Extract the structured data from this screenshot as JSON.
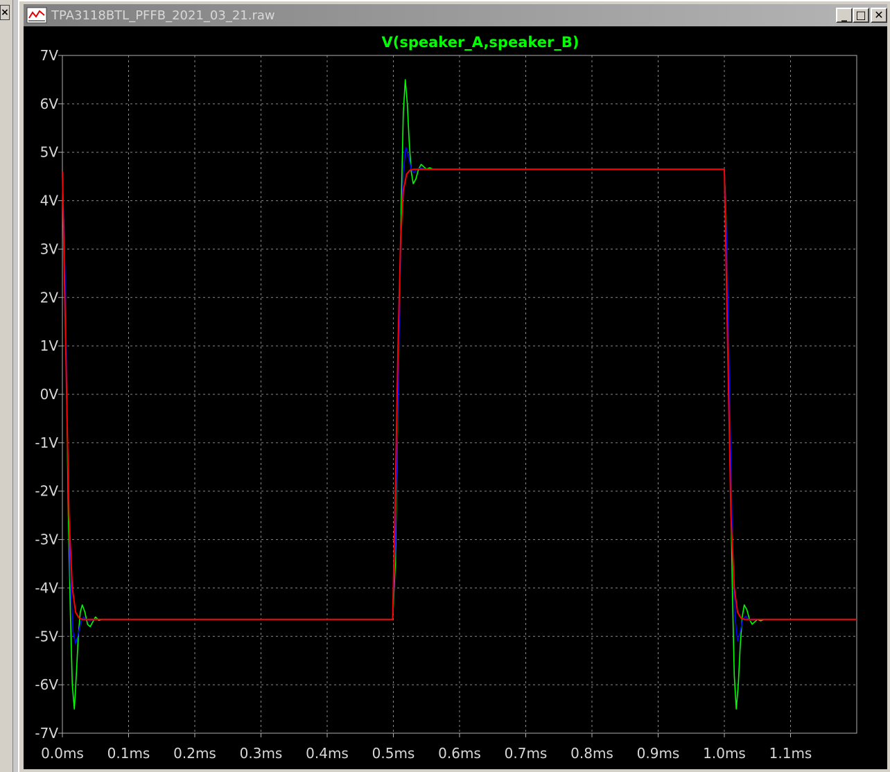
{
  "window": {
    "title": "TPA3118BTL_PFFB_2021_03_21.raw",
    "minimize_label": "_",
    "restore_label": "□",
    "close_label": "✕",
    "left_close_label": "×"
  },
  "plot": {
    "trace_title": "V(speaker_A,speaker_B)",
    "title_color": "#00ff00",
    "background": "#000000"
  },
  "chart_data": {
    "type": "line",
    "title": "V(speaker_A,speaker_B)",
    "xlabel": "",
    "ylabel": "",
    "x_unit": "ms",
    "y_unit": "V",
    "xlim": [
      0.0,
      1.2
    ],
    "ylim": [
      -7,
      7
    ],
    "grid": true,
    "x_ticks": [
      "0.0ms",
      "0.1ms",
      "0.2ms",
      "0.3ms",
      "0.4ms",
      "0.5ms",
      "0.6ms",
      "0.7ms",
      "0.8ms",
      "0.9ms",
      "1.0ms",
      "1.1ms"
    ],
    "y_ticks": [
      "7V",
      "6V",
      "5V",
      "4V",
      "3V",
      "2V",
      "1V",
      "0V",
      "-1V",
      "-2V",
      "-3V",
      "-4V",
      "-5V",
      "-6V",
      "-7V"
    ],
    "series": [
      {
        "color": "#00ff00",
        "x": [
          0.0,
          0.003,
          0.006,
          0.009,
          0.012,
          0.015,
          0.018,
          0.021,
          0.024,
          0.027,
          0.03,
          0.034,
          0.038,
          0.042,
          0.046,
          0.05,
          0.055,
          0.06,
          0.1,
          0.2,
          0.3,
          0.4,
          0.499,
          0.503,
          0.506,
          0.509,
          0.512,
          0.515,
          0.518,
          0.521,
          0.524,
          0.527,
          0.53,
          0.534,
          0.538,
          0.542,
          0.546,
          0.55,
          0.555,
          0.56,
          0.6,
          0.7,
          0.8,
          0.9,
          1.0,
          1.003,
          1.006,
          1.009,
          1.012,
          1.015,
          1.018,
          1.021,
          1.024,
          1.027,
          1.03,
          1.034,
          1.038,
          1.042,
          1.046,
          1.05,
          1.055,
          1.06,
          1.1,
          1.2
        ],
        "y": [
          4.6,
          3.0,
          0.5,
          -2.5,
          -4.5,
          -6.0,
          -6.5,
          -5.8,
          -5.0,
          -4.5,
          -4.35,
          -4.5,
          -4.75,
          -4.8,
          -4.7,
          -4.6,
          -4.67,
          -4.65,
          -4.65,
          -4.65,
          -4.65,
          -4.65,
          -4.65,
          -3.5,
          -1.0,
          1.5,
          4.0,
          5.8,
          6.5,
          6.0,
          5.2,
          4.6,
          4.35,
          4.45,
          4.65,
          4.75,
          4.7,
          4.65,
          4.68,
          4.65,
          4.65,
          4.65,
          4.65,
          4.65,
          4.65,
          3.5,
          1.0,
          -1.5,
          -4.0,
          -5.8,
          -6.5,
          -6.0,
          -5.2,
          -4.6,
          -4.35,
          -4.45,
          -4.65,
          -4.75,
          -4.7,
          -4.65,
          -4.68,
          -4.65,
          -4.65,
          -4.65
        ]
      },
      {
        "color": "#0000ff",
        "x": [
          0.0,
          0.004,
          0.008,
          0.012,
          0.016,
          0.02,
          0.024,
          0.028,
          0.032,
          0.036,
          0.04,
          0.05,
          0.1,
          0.3,
          0.499,
          0.503,
          0.507,
          0.511,
          0.515,
          0.519,
          0.523,
          0.527,
          0.531,
          0.535,
          0.54,
          0.55,
          0.7,
          0.9,
          1.0,
          1.004,
          1.008,
          1.012,
          1.016,
          1.02,
          1.024,
          1.028,
          1.032,
          1.036,
          1.04,
          1.05,
          1.2
        ],
        "y": [
          4.6,
          2.5,
          -1.0,
          -3.8,
          -4.9,
          -5.15,
          -4.95,
          -4.7,
          -4.6,
          -4.65,
          -4.68,
          -4.65,
          -4.65,
          -4.65,
          -4.65,
          -3.0,
          0.0,
          3.0,
          4.6,
          5.1,
          4.9,
          4.65,
          4.58,
          4.64,
          4.67,
          4.65,
          4.65,
          4.65,
          4.65,
          3.0,
          0.0,
          -3.0,
          -4.6,
          -5.1,
          -4.9,
          -4.65,
          -4.58,
          -4.64,
          -4.67,
          -4.65,
          -4.65
        ]
      },
      {
        "color": "#ff0000",
        "x": [
          0.0,
          0.005,
          0.01,
          0.015,
          0.02,
          0.025,
          0.03,
          0.1,
          0.3,
          0.499,
          0.503,
          0.507,
          0.511,
          0.515,
          0.52,
          0.525,
          0.53,
          0.7,
          0.9,
          1.0,
          1.005,
          1.01,
          1.015,
          1.02,
          1.025,
          1.03,
          1.2
        ],
        "y": [
          4.6,
          1.0,
          -2.5,
          -4.0,
          -4.5,
          -4.62,
          -4.65,
          -4.65,
          -4.65,
          -4.65,
          -2.0,
          1.0,
          3.2,
          4.2,
          4.55,
          4.63,
          4.65,
          4.65,
          4.65,
          4.65,
          1.0,
          -2.5,
          -4.0,
          -4.5,
          -4.62,
          -4.65,
          -4.65
        ]
      }
    ]
  }
}
